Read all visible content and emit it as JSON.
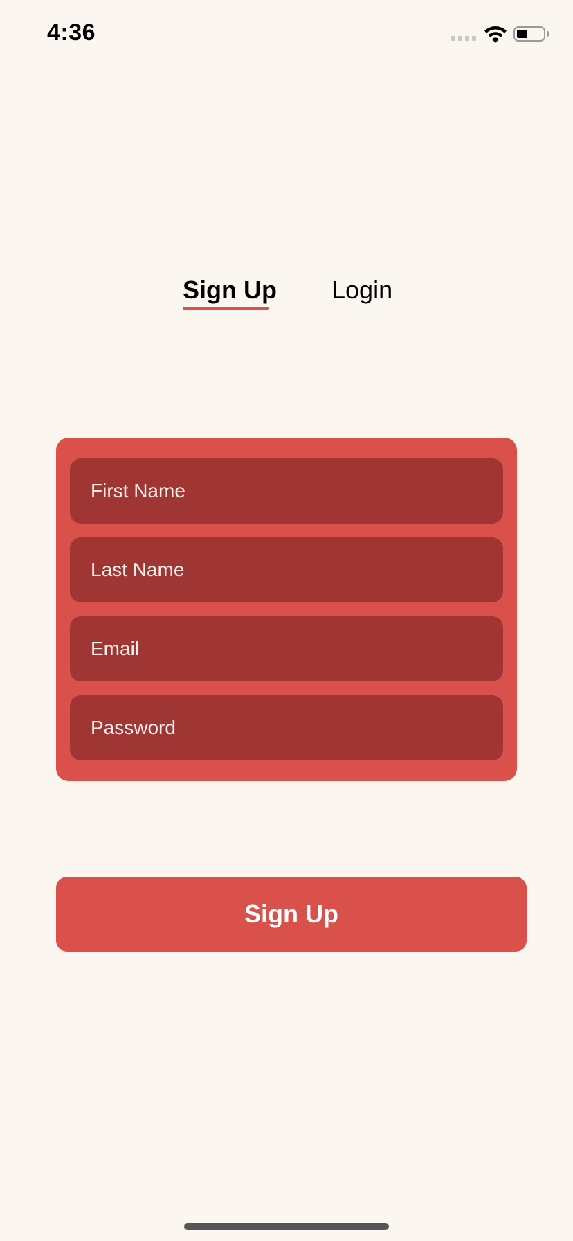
{
  "status_bar": {
    "time": "4:36",
    "icons": [
      "cellular-signal-icon",
      "wifi-icon",
      "battery-icon"
    ]
  },
  "tabs": [
    {
      "label": "Sign Up",
      "active": true
    },
    {
      "label": "Login",
      "active": false
    }
  ],
  "form": {
    "fields": [
      {
        "placeholder": "First Name",
        "value": ""
      },
      {
        "placeholder": "Last Name",
        "value": ""
      },
      {
        "placeholder": "Email",
        "value": ""
      },
      {
        "placeholder": "Password",
        "value": ""
      }
    ]
  },
  "primary_button": {
    "label": "Sign Up"
  },
  "colors": {
    "background": "#fbf7f0",
    "accent": "#d9514a",
    "field_background": "#a03633",
    "field_text": "#f7eee8",
    "button_text": "#ffffff"
  }
}
